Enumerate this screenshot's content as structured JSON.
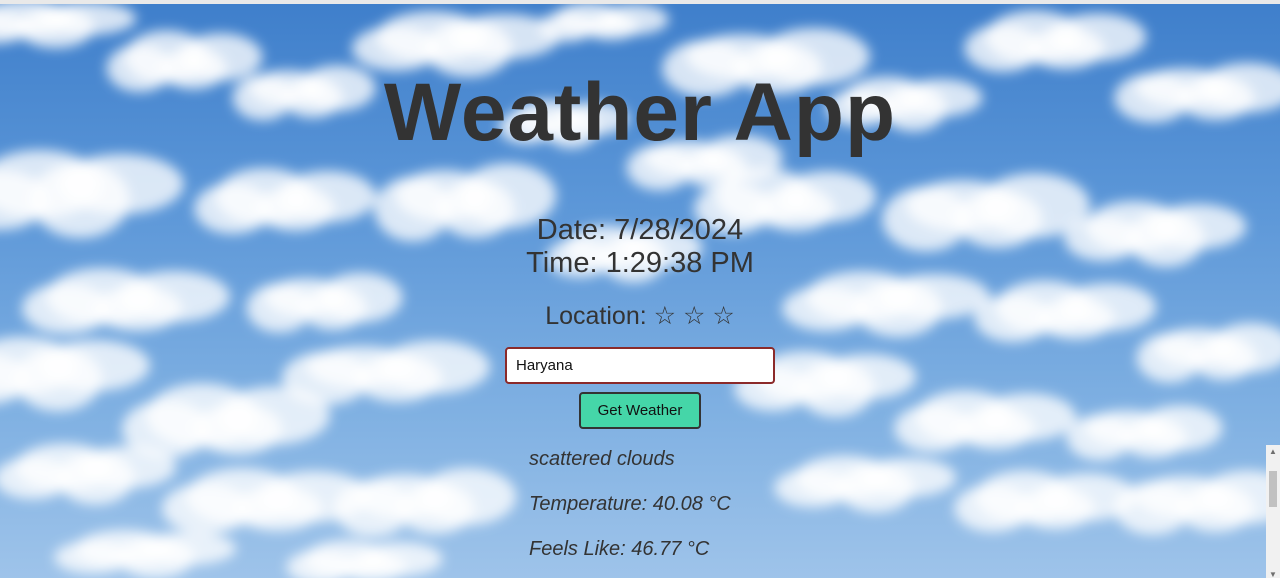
{
  "app": {
    "title": "Weather App"
  },
  "datetime": {
    "date_text": "Date: 7/28/2024",
    "time_text": "Time: 1:29:38 PM"
  },
  "location": {
    "label": "Location: ☆ ☆ ☆"
  },
  "search": {
    "value": "Haryana",
    "button_label": "Get Weather"
  },
  "weather": {
    "description": "scattered clouds",
    "temperature_text": "Temperature: 40.08 °C",
    "feels_like_text": "Feels Like: 46.77 °C"
  },
  "scrollbar": {
    "up_glyph": "▲",
    "down_glyph": "▼"
  },
  "colors": {
    "title": "#333333",
    "button_bg": "#45d6a8",
    "input_border": "#8b2a2a",
    "sky": "#5c97d8"
  },
  "icons": {
    "background": "cloudy-sky-background"
  }
}
